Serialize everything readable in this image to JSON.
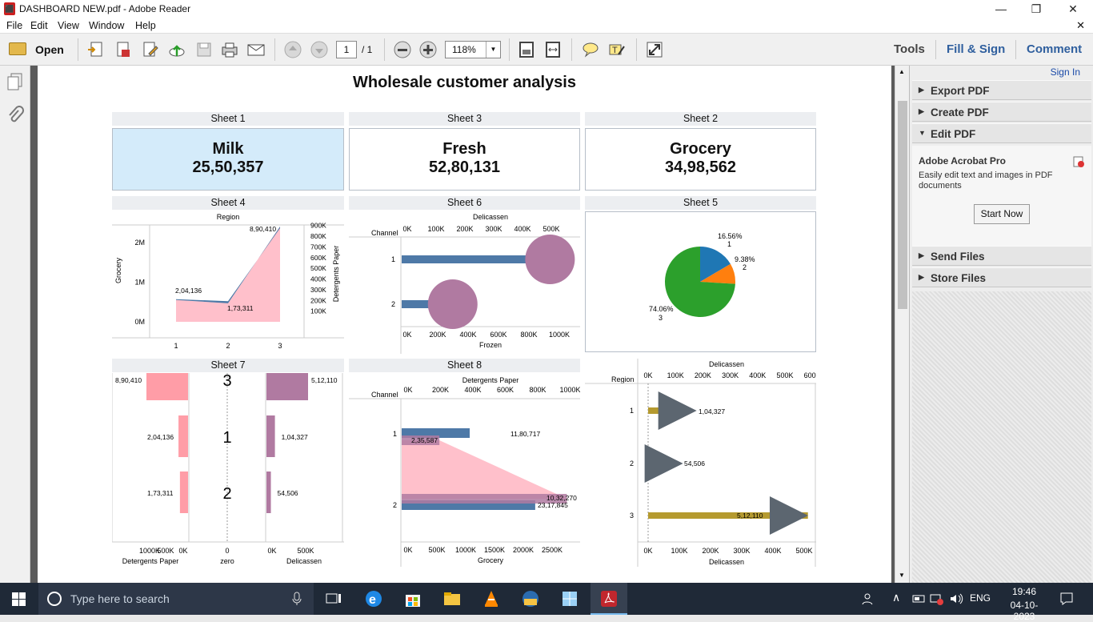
{
  "window": {
    "title": "DASHBOARD NEW.pdf - Adobe Reader",
    "minimize": "—",
    "restore": "❐",
    "close": "✕"
  },
  "menu": {
    "items": [
      "File",
      "Edit",
      "View",
      "Window",
      "Help"
    ],
    "close_doc": "✕"
  },
  "toolbar": {
    "open_label": "Open",
    "page_current": "1",
    "page_total": "/ 1",
    "zoom": "118%",
    "tools": "Tools",
    "fill_sign": "Fill & Sign",
    "comment": "Comment"
  },
  "right_panel": {
    "sign_in": "Sign In",
    "export_pdf": "Export PDF",
    "create_pdf": "Create PDF",
    "edit_pdf": "Edit PDF",
    "promo_title": "Adobe Acrobat Pro",
    "promo_text": "Easily edit text and images in PDF documents",
    "start_now": "Start Now",
    "send_files": "Send Files",
    "store_files": "Store Files"
  },
  "document": {
    "title": "Wholesale customer analysis",
    "kpis": [
      {
        "sheet": "Sheet 1",
        "label": "Milk",
        "value": "25,50,357"
      },
      {
        "sheet": "Sheet 3",
        "label": "Fresh",
        "value": "52,80,131"
      },
      {
        "sheet": "Sheet 2",
        "label": "Grocery",
        "value": "34,98,562"
      }
    ],
    "sheet_titles": {
      "s4": "Sheet 4",
      "s6": "Sheet 6",
      "s5": "Sheet 5",
      "s7": "Sheet 7",
      "s8": "Sheet 8"
    }
  },
  "chart_data": [
    {
      "type": "area",
      "id": "sheet4",
      "title": "Region",
      "ylabel": "Grocery",
      "y2label": "Detergents Paper",
      "x": [
        "1",
        "2",
        "3"
      ],
      "y_ticks": [
        "0M",
        "1M",
        "2M"
      ],
      "y2_ticks": [
        "100K",
        "200K",
        "300K",
        "400K",
        "500K",
        "600K",
        "700K",
        "800K",
        "900K"
      ],
      "series": [
        {
          "name": "Grocery",
          "color": "#4e79a7",
          "values": [
            570000,
            520000,
            2360000
          ]
        },
        {
          "name": "Detergents Paper",
          "color": "#ffc0cb",
          "values": [
            204136,
            173311,
            890410
          ]
        }
      ],
      "labels": [
        "8,90,410",
        "2,04,136",
        "1,73,311"
      ]
    },
    {
      "type": "bar",
      "id": "sheet6",
      "title": "Delicassen",
      "xlabel": "Frozen",
      "ylabel": "Channel",
      "categories": [
        "1",
        "2"
      ],
      "top_ticks": [
        "0K",
        "100K",
        "200K",
        "300K",
        "400K",
        "500K"
      ],
      "bottom_ticks": [
        "0K",
        "200K",
        "400K",
        "600K",
        "800K",
        "1000K"
      ],
      "series": [
        {
          "name": "Frozen",
          "color": "#4e79a7",
          "values": [
            830000,
            240000
          ]
        },
        {
          "name": "Delicassen",
          "color": "#b07aa1",
          "values": [
            410000,
            320000
          ]
        }
      ]
    },
    {
      "type": "pie",
      "id": "sheet5",
      "slices": [
        {
          "label": "16.56%",
          "cat": "1",
          "value": 16.56,
          "color": "#1f77b4"
        },
        {
          "label": "9.38%",
          "cat": "2",
          "value": 9.38,
          "color": "#ff7f0e"
        },
        {
          "label": "74.06%",
          "cat": "3",
          "value": 74.06,
          "color": "#2ca02c"
        }
      ]
    },
    {
      "type": "bar",
      "id": "sheet7",
      "rows": [
        {
          "label": "3",
          "det": 890410,
          "det_label": "8,90,410",
          "deli": 512110,
          "deli_label": "5,12,110"
        },
        {
          "label": "1",
          "det": 204136,
          "det_label": "2,04,136",
          "deli": 104327,
          "deli_label": "1,04,327"
        },
        {
          "label": "2",
          "det": 173311,
          "det_label": "1,73,311",
          "deli": 54506,
          "deli_label": "54,506"
        }
      ],
      "axes": {
        "left": "Detergents Paper",
        "mid": "zero",
        "right": "Delicassen",
        "left_ticks": [
          "1000K",
          "500K",
          "0K"
        ],
        "mid_ticks": [
          "0"
        ],
        "right_ticks": [
          "0K",
          "500K"
        ]
      }
    },
    {
      "type": "bar",
      "id": "sheet8",
      "title": "Detergents Paper",
      "xlabel": "Grocery",
      "ylabel": "Channel",
      "categories": [
        "1",
        "2"
      ],
      "top_ticks": [
        "0K",
        "200K",
        "400K",
        "600K",
        "800K",
        "1000K"
      ],
      "bottom_ticks": [
        "0K",
        "500K",
        "1000K",
        "1500K",
        "2000K",
        "2500K"
      ],
      "grocery": [
        1180717,
        2317845
      ],
      "grocery_labels": [
        "11,80,717",
        "23,17,845"
      ],
      "detergents": [
        235587,
        1032270
      ],
      "detergents_labels": [
        "2,35,587",
        "10,32,270"
      ]
    },
    {
      "type": "bar",
      "id": "sheet9",
      "title": "Delicassen",
      "xlabel": "Delicassen",
      "ylabel": "Region",
      "categories": [
        "1",
        "2",
        "3"
      ],
      "top_ticks": [
        "0K",
        "100K",
        "200K",
        "300K",
        "400K",
        "500K",
        "600K"
      ],
      "bottom_ticks": [
        "0K",
        "100K",
        "200K",
        "300K",
        "400K",
        "500K"
      ],
      "values": [
        104327,
        54506,
        512110
      ],
      "labels": [
        "1,04,327",
        "54,506",
        "5,12,110"
      ]
    }
  ],
  "taskbar": {
    "search": "Type here to search",
    "lang": "ENG",
    "time": "19:46",
    "date": "04-10-2023"
  }
}
